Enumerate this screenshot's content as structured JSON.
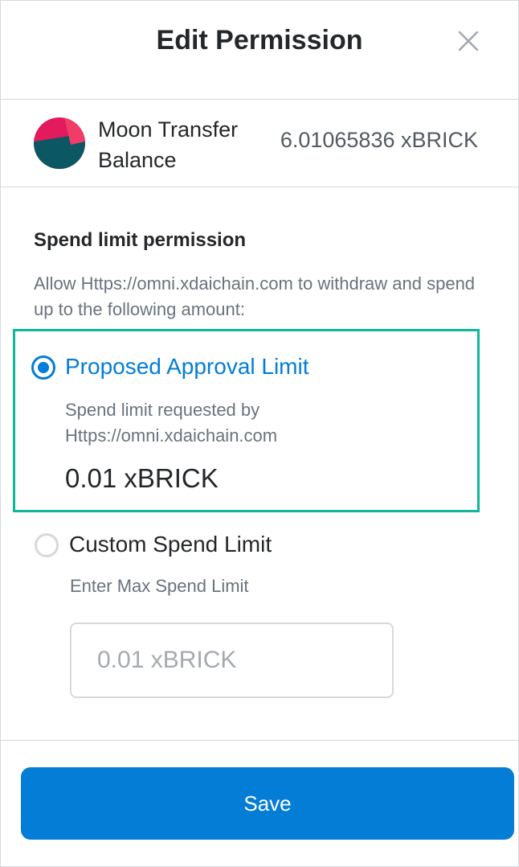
{
  "header": {
    "title": "Edit Permission",
    "close_icon": "close-icon"
  },
  "token": {
    "name": "Moon Transfer Balance",
    "balance": "6.01065836 xBRICK",
    "avatar_colors": [
      "#e31a5d",
      "#0b5763",
      "#f03c68"
    ]
  },
  "permission": {
    "title": "Spend limit permission",
    "description": "Allow Https://omni.xdaichain.com to withdraw and spend up to the following amount:",
    "proposed": {
      "label": "Proposed Approval Limit",
      "description": "Spend limit requested by Https://omni.xdaichain.com",
      "amount": "0.01 xBRICK",
      "selected": true
    },
    "custom": {
      "label": "Custom Spend Limit",
      "hint": "Enter Max Spend Limit",
      "placeholder": "0.01 xBRICK",
      "value": "",
      "selected": false
    }
  },
  "footer": {
    "save_label": "Save"
  },
  "colors": {
    "accent": "#037dd6",
    "selected_border": "#10b796",
    "divider": "#d6d9dc"
  }
}
